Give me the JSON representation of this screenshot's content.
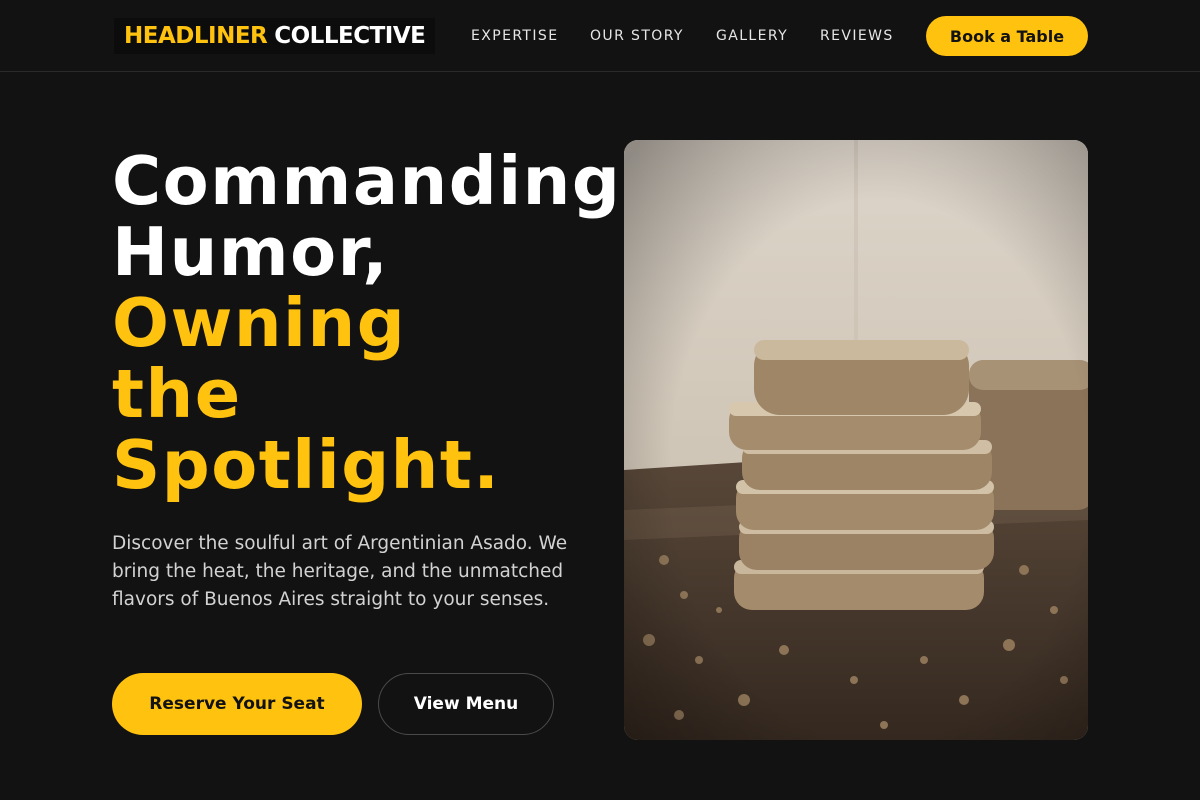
{
  "header": {
    "logo_accent": "HEADLINER",
    "logo_rest": "COLLECTIVE",
    "nav": {
      "expertise": "EXPERTISE",
      "story": "OUR STORY",
      "gallery": "GALLERY",
      "reviews": "REVIEWS"
    },
    "cta_label": "Book a Table"
  },
  "hero": {
    "title_white_1": "Commanding",
    "title_white_2": "Humor,",
    "title_gold_1": "Owning",
    "title_gold_2": "the",
    "title_gold_3": "Spotlight.",
    "description": "Discover the soulful art of Argentinian Asado. We bring the heat, the heritage, and the unmatched flavors of Buenos Aires straight to your senses.",
    "primary_button": "Reserve Your Seat",
    "secondary_button": "View Menu",
    "photo_subject": "stack-of-sliced-bread-photo"
  },
  "colors": {
    "background": "#121212",
    "accent": "#ffc20e",
    "text": "#ffffff",
    "muted_text": "#d2d2d2"
  }
}
